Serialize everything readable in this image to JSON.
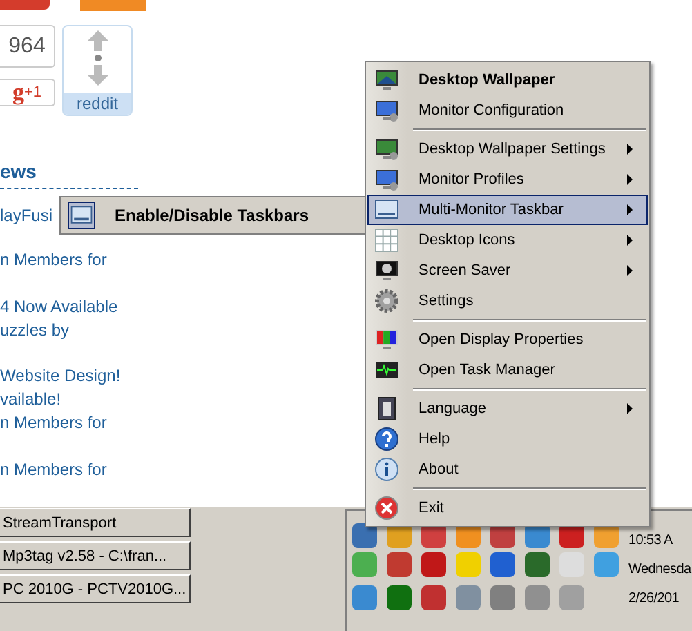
{
  "web_page": {
    "share_count": "964",
    "gplus": {
      "letter": "g",
      "plus": "+1"
    },
    "reddit": "reddit",
    "section_title": "ews",
    "news_lines": [
      "layFusi",
      "n Members for",
      "4 Now Available",
      "uzzles by",
      "Website Design!",
      "vailable!",
      "n Members for",
      "n Members for"
    ]
  },
  "context_menu": {
    "items": [
      {
        "kind": "item",
        "label": "Desktop Wallpaper",
        "bold": true,
        "submenu": false,
        "selected": false
      },
      {
        "kind": "item",
        "label": "Monitor Configuration",
        "bold": false,
        "submenu": false,
        "selected": false
      },
      {
        "kind": "separator"
      },
      {
        "kind": "item",
        "label": "Desktop Wallpaper Settings",
        "bold": false,
        "submenu": true,
        "selected": false
      },
      {
        "kind": "item",
        "label": "Monitor Profiles",
        "bold": false,
        "submenu": true,
        "selected": false
      },
      {
        "kind": "item",
        "label": "Multi-Monitor Taskbar",
        "bold": false,
        "submenu": true,
        "selected": true
      },
      {
        "kind": "item",
        "label": "Desktop Icons",
        "bold": false,
        "submenu": true,
        "selected": false
      },
      {
        "kind": "item",
        "label": "Screen Saver",
        "bold": false,
        "submenu": true,
        "selected": false
      },
      {
        "kind": "item",
        "label": "Settings",
        "bold": false,
        "submenu": false,
        "selected": false
      },
      {
        "kind": "separator"
      },
      {
        "kind": "item",
        "label": "Open Display Properties",
        "bold": false,
        "submenu": false,
        "selected": false
      },
      {
        "kind": "item",
        "label": "Open Task Manager",
        "bold": false,
        "submenu": false,
        "selected": false
      },
      {
        "kind": "separator"
      },
      {
        "kind": "item",
        "label": "Language",
        "bold": false,
        "submenu": true,
        "selected": false
      },
      {
        "kind": "item",
        "label": "Help",
        "bold": false,
        "submenu": false,
        "selected": false
      },
      {
        "kind": "item",
        "label": "About",
        "bold": false,
        "submenu": false,
        "selected": false
      },
      {
        "kind": "separator"
      },
      {
        "kind": "item",
        "label": "Exit",
        "bold": false,
        "submenu": false,
        "selected": false
      }
    ]
  },
  "submenu": {
    "items": [
      {
        "label": "Enable/Disable Taskbars",
        "bold": true
      }
    ]
  },
  "taskbar": {
    "buttons": [
      "StreamTransport",
      "Mp3tag v2.58  -  C:\\fran...",
      "PC 2010G - PCTV2010G..."
    ],
    "clock": {
      "time": "10:53 A",
      "day": "Wednesda",
      "date": "2/26/201"
    }
  }
}
